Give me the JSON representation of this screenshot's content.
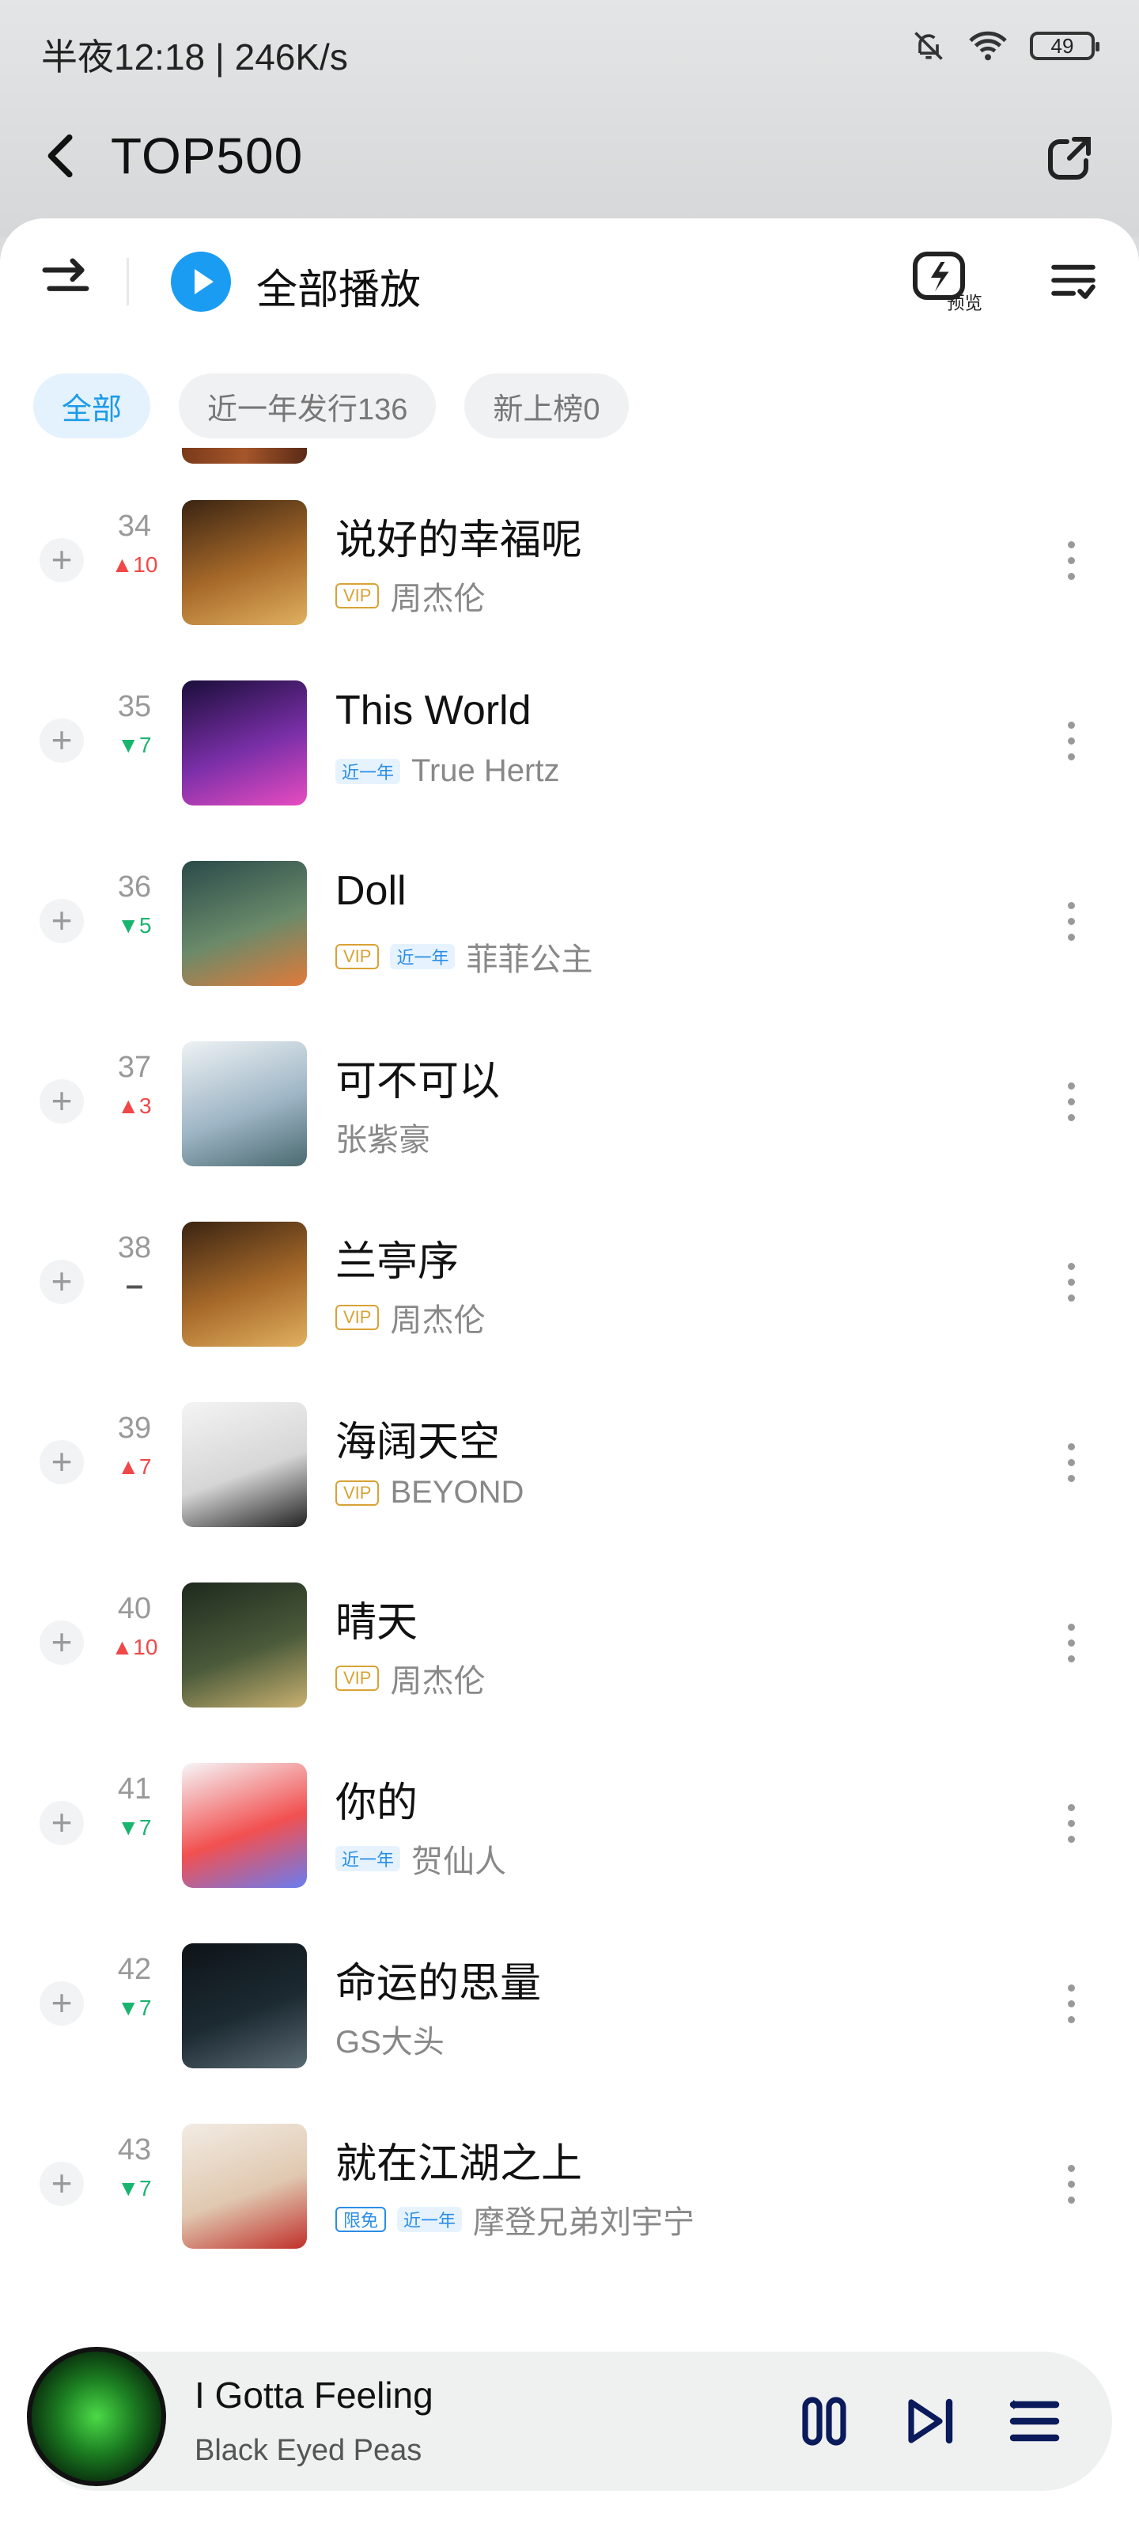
{
  "status_bar": {
    "time": "半夜12:18 | 246K/s",
    "battery": "49"
  },
  "nav": {
    "title": "TOP500"
  },
  "toolbar": {
    "play_all": "全部播放",
    "preview_label": "预览"
  },
  "chips": [
    {
      "label": "全部",
      "active": true
    },
    {
      "label": "近一年发行136",
      "active": false
    },
    {
      "label": "新上榜0",
      "active": false
    }
  ],
  "songs": [
    {
      "rank": "34",
      "trend": "▲10",
      "trend_dir": "up",
      "title": "说好的幸福呢",
      "vip": "VIP",
      "recent": "",
      "free": "",
      "artist": "周杰伦",
      "cover": [
        "#3a2412",
        "#a86a2a",
        "#e0b060"
      ]
    },
    {
      "rank": "35",
      "trend": "▼7",
      "trend_dir": "down",
      "title": "This World",
      "vip": "",
      "recent": "近一年",
      "free": "",
      "artist": "True Hertz",
      "cover": [
        "#1b0e3a",
        "#7a2fa8",
        "#e84cc0"
      ]
    },
    {
      "rank": "36",
      "trend": "▼5",
      "trend_dir": "down",
      "title": "Doll",
      "vip": "VIP",
      "recent": "近一年",
      "free": "",
      "artist": "菲菲公主",
      "cover": [
        "#2a4a4a",
        "#6a8a6a",
        "#e07a3a"
      ]
    },
    {
      "rank": "37",
      "trend": "▲3",
      "trend_dir": "up",
      "title": "可不可以",
      "vip": "",
      "recent": "",
      "free": "",
      "artist": "张紫豪",
      "cover": [
        "#eef2f4",
        "#9fb6c6",
        "#4a6a70"
      ]
    },
    {
      "rank": "38",
      "trend": "–",
      "trend_dir": "flat",
      "title": "兰亭序",
      "vip": "VIP",
      "recent": "",
      "free": "",
      "artist": "周杰伦",
      "cover": [
        "#3a2412",
        "#a86a2a",
        "#e0b060"
      ]
    },
    {
      "rank": "39",
      "trend": "▲7",
      "trend_dir": "up",
      "title": "海阔天空",
      "vip": "VIP",
      "recent": "",
      "free": "",
      "artist": "BEYOND",
      "cover": [
        "#f4f4f4",
        "#d6d6d6",
        "#222222"
      ]
    },
    {
      "rank": "40",
      "trend": "▲10",
      "trend_dir": "up",
      "title": "晴天",
      "vip": "VIP",
      "recent": "",
      "free": "",
      "artist": "周杰伦",
      "cover": [
        "#1e2a1e",
        "#4a5a3a",
        "#c8b070"
      ]
    },
    {
      "rank": "41",
      "trend": "▼7",
      "trend_dir": "down",
      "title": "你的",
      "vip": "",
      "recent": "近一年",
      "free": "",
      "artist": "贺仙人",
      "cover": [
        "#f6f6f8",
        "#f25050",
        "#6a7cf0"
      ]
    },
    {
      "rank": "42",
      "trend": "▼7",
      "trend_dir": "down",
      "title": "命运的思量",
      "vip": "",
      "recent": "",
      "free": "",
      "artist": "GS大头",
      "cover": [
        "#0e1418",
        "#1c2a32",
        "#5a6a72"
      ]
    },
    {
      "rank": "43",
      "trend": "▼7",
      "trend_dir": "down",
      "title": "就在江湖之上",
      "vip": "",
      "recent": "近一年",
      "free": "限免",
      "artist": "摩登兄弟刘宇宁",
      "cover": [
        "#f2ece4",
        "#e0c8b0",
        "#c0302a"
      ]
    }
  ],
  "player": {
    "title": "I Gotta Feeling",
    "artist": "Black Eyed Peas"
  }
}
